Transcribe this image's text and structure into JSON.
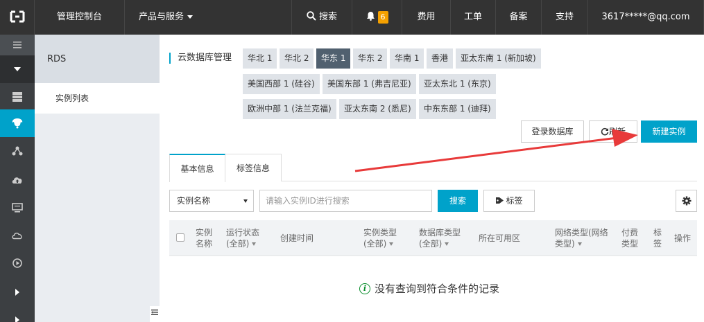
{
  "topbar": {
    "console": "管理控制台",
    "products": "产品与服务",
    "search": "搜索",
    "notifications": "6",
    "fee": "费用",
    "ticket": "工单",
    "record": "备案",
    "support": "支持",
    "user": "3617*****@qq.com"
  },
  "sidebar": {
    "title": "RDS",
    "items": [
      {
        "label": "实例列表"
      }
    ]
  },
  "region": {
    "label": "云数据库管理",
    "rows": [
      [
        "华北 1",
        "华北 2",
        "华东 1",
        "华东 2",
        "华南 1",
        "香港",
        "亚太东南 1 (新加坡)"
      ],
      [
        "美国西部 1 (硅谷)",
        "美国东部 1 (弗吉尼亚)",
        "亚太东北 1 (东京)"
      ],
      [
        "欧洲中部 1 (法兰克福)",
        "亚太东南 2 (悉尼)",
        "中东东部 1 (迪拜)"
      ]
    ],
    "selected": "华东 1"
  },
  "actions": {
    "login_db": "登录数据库",
    "refresh": "刷新",
    "create": "新建实例"
  },
  "tabs": [
    {
      "label": "基本信息"
    },
    {
      "label": "标签信息"
    }
  ],
  "filter": {
    "select_value": "实例名称",
    "search_placeholder": "请输入实例ID进行搜索",
    "search_button": "搜索",
    "tag_button": "标签"
  },
  "table": {
    "columns": [
      {
        "line1": "实例",
        "line2": "名称"
      },
      {
        "line1": "运行状态",
        "line2": "(全部)"
      },
      {
        "line1": "创建时间",
        "line2": ""
      },
      {
        "line1": "实例类型",
        "line2": "(全部)"
      },
      {
        "line1": "数据库类型",
        "line2": "(全部)"
      },
      {
        "line1": "所在可用区",
        "line2": ""
      },
      {
        "line1": "网络类型(网络",
        "line2": "类型)"
      },
      {
        "line1": "付费",
        "line2": "类型"
      },
      {
        "line1": "标",
        "line2": "签"
      },
      {
        "line1": "操作",
        "line2": ""
      }
    ],
    "empty_message": "没有查询到符合条件的记录"
  },
  "colors": {
    "accent": "#00a2ca",
    "topbar": "#333333",
    "arrow": "#e83a3a"
  }
}
